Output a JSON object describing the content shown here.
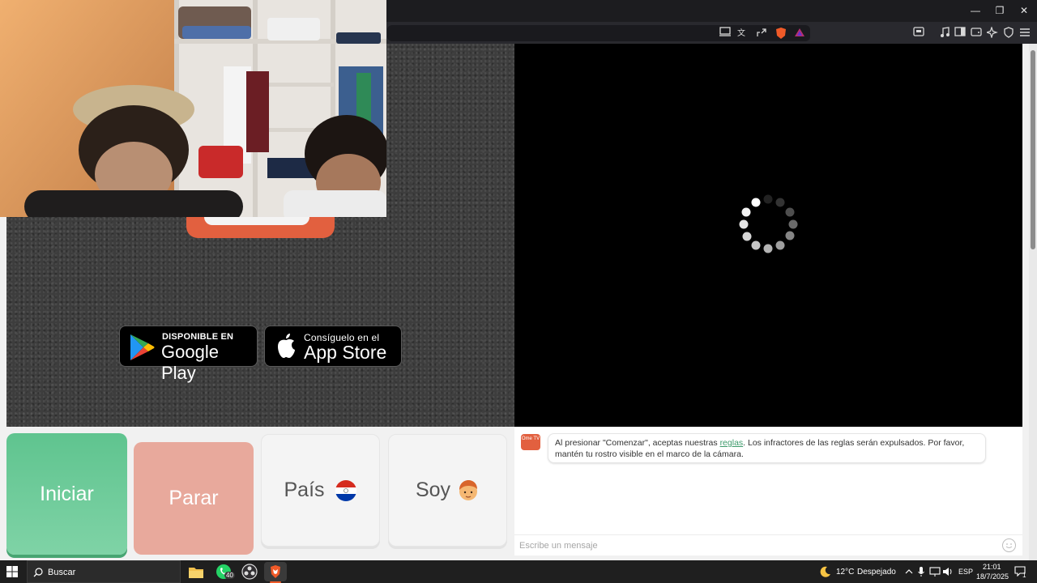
{
  "window": {
    "controls": {
      "minimize": "—",
      "restore": "❐",
      "close": "✕"
    }
  },
  "store_badges": {
    "google": {
      "small": "DISPONIBLE EN",
      "big": "Google Play"
    },
    "apple": {
      "small": "Consíguelo en el",
      "big": "App Store"
    }
  },
  "controls": {
    "start_label": "Iniciar",
    "stop_label": "Parar",
    "country_label": "País",
    "country_flag": "Paraguay",
    "gender_label": "Soy"
  },
  "chat": {
    "logo_text": "Ome TV",
    "message_before": "Al presionar \"Comenzar\", aceptas nuestras",
    "message_link": "reglas",
    "message_after": ". Los infractores de las reglas serán expulsados. Por favor, mantén tu rostro visible en el marco de la cámara.",
    "input_placeholder": "Escribe un mensaje"
  },
  "taskbar": {
    "search_placeholder": "Buscar",
    "whatsapp_badge": "40",
    "weather_temp": "12°C",
    "weather_desc": "Despejado",
    "language": "ESP",
    "time": "21:01",
    "date": "18/7/2025",
    "notification_count": "1"
  },
  "colors": {
    "start_green": "#5fc48f",
    "stop_salmon": "#e8a99c",
    "brand_orange": "#e2603f",
    "link_green": "#3d9a6b"
  }
}
